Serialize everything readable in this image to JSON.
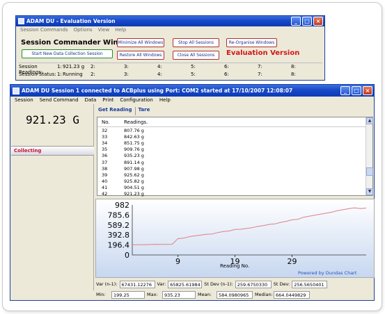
{
  "commander": {
    "title": "ADAM DU - Evaluation Version",
    "menu": [
      "Session Commands",
      "Options",
      "View",
      "Help"
    ],
    "heading": "Session Commander Window",
    "buttons": {
      "start_new": "Start New Data Collection Session",
      "minimize_all": "Minimize All Windows",
      "restore_all": "Restore All Windows",
      "stop_all": "Stop All Sessions",
      "close_all": "Close All Sessions",
      "reorganise": "Re-Organise Windows"
    },
    "evaluation_label": "Evaluation Version",
    "readings_label": "Session Readings:",
    "status_label": "Session Status:",
    "slot_labels": [
      "1:",
      "2:",
      "3:",
      "4:",
      "5:",
      "6:",
      "7:",
      "8:"
    ],
    "readings": [
      "921.23 g",
      "",
      "",
      "",
      "",
      "",
      "",
      ""
    ],
    "statuses": [
      "Running",
      "",
      "",
      "",
      "",
      "",
      "",
      ""
    ]
  },
  "session": {
    "title": "ADAM DU Session 1 connected to ACBplus using Port: COM2 started at 17/10/2007 12:08:07",
    "menu": [
      "Session",
      "Send Command",
      "Data",
      "Print",
      "Configuration",
      "Help"
    ],
    "current_weight": "921.23 G",
    "status": "Collecting",
    "tabs": [
      "Get Reading",
      "Tare"
    ],
    "table": {
      "headers": [
        "No.",
        "Readings."
      ],
      "rows": [
        [
          "32",
          "807.76 g"
        ],
        [
          "33",
          "842.63 g"
        ],
        [
          "34",
          "851.75 g"
        ],
        [
          "35",
          "909.76 g"
        ],
        [
          "36",
          "935.23 g"
        ],
        [
          "37",
          "891.14 g"
        ],
        [
          "38",
          "907.98 g"
        ],
        [
          "39",
          "925.62 g"
        ],
        [
          "40",
          "925.82 g"
        ],
        [
          "41",
          "904.51 g"
        ],
        [
          "42",
          "921.23 g"
        ]
      ]
    },
    "stats": {
      "var_n1_label": "Var (n-1):",
      "var_n1": "67431.12276",
      "var_label": "Var:",
      "var": "65825.61984",
      "stdev_n1_label": "St Dev (n-1):",
      "stdev_n1": "259.6750330",
      "stdev_label": "St Dev:",
      "stdev": "256.5650401",
      "min_label": "Min:",
      "min": "199.25",
      "max_label": "Max:",
      "max": "935.23",
      "mean_label": "Mean:",
      "mean": "584.0980965",
      "median_label": "Median:",
      "median": "664.0449829"
    }
  },
  "chart_data": {
    "type": "line",
    "xlabel": "Reading No.",
    "ylabel": "",
    "watermark": "Powered by Dundas Chart",
    "x_ticks": [
      "9",
      "19",
      "29"
    ],
    "y_ticks": [
      "982",
      "785.6",
      "589.2",
      "392.8",
      "196.4",
      "0"
    ],
    "ylim": [
      0,
      982
    ],
    "xlim": [
      1,
      42
    ],
    "grid": false,
    "series": [
      {
        "color": "#e08080",
        "x": [
          1,
          2,
          3,
          4,
          5,
          6,
          7,
          8,
          9,
          10,
          11,
          12,
          13,
          14,
          15,
          16,
          17,
          18,
          19,
          20,
          21,
          22,
          23,
          24,
          25,
          26,
          27,
          28,
          29,
          30,
          31,
          32,
          33,
          34,
          35,
          36,
          37,
          38,
          39,
          40,
          41,
          42
        ],
        "values": [
          199.25,
          200,
          202,
          205,
          207,
          206,
          208,
          210,
          320,
          330,
          360,
          375,
          390,
          405,
          410,
          440,
          460,
          470,
          500,
          505,
          520,
          535,
          560,
          575,
          600,
          610,
          640,
          660,
          690,
          700,
          740,
          760,
          780,
          800,
          820,
          840,
          870,
          890,
          910,
          925,
          910,
          921.23
        ]
      }
    ]
  },
  "colors": {
    "titlebar": "#1749c8",
    "evaluation_red": "#d01818",
    "collecting_red": "#c8102e",
    "tab_blue": "#1a3a9a"
  }
}
